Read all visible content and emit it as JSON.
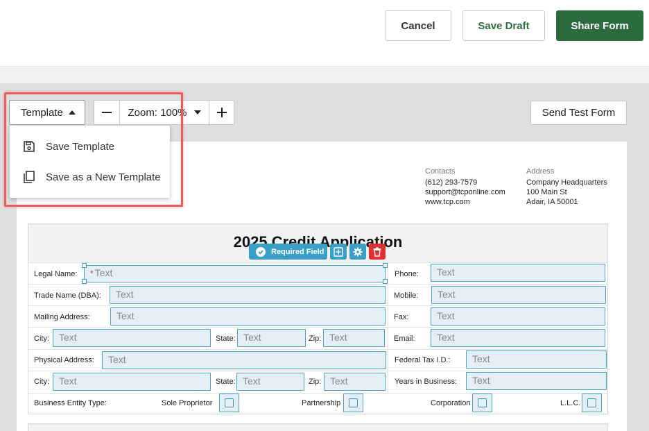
{
  "header": {
    "cancel_label": "Cancel",
    "save_draft_label": "Save Draft",
    "share_form_label": "Share Form",
    "accent_color": "#2b6b3d"
  },
  "toolbar": {
    "template_label": "Template",
    "zoom_label": "Zoom: 100%",
    "send_test_label": "Send Test Form"
  },
  "template_menu": {
    "items": [
      {
        "label": "Save Template",
        "icon": "save-icon"
      },
      {
        "label": "Save as a New Template",
        "icon": "copy-icon"
      }
    ]
  },
  "company": {
    "contacts_heading": "Contacts",
    "phone": "(612) 293-7579",
    "email": "support@tcponline.com",
    "web": "www.tcp.com",
    "address_heading": "Address",
    "address_line1": "Company Headquarters",
    "address_line2": "100 Main St",
    "address_line3": "Adair, IA 50001"
  },
  "form": {
    "title": "2025 Credit Application",
    "required_field_label": "Required Field",
    "placeholder": "Text",
    "required_marker": "*",
    "labels": {
      "legal_name": "Legal Name:",
      "trade_name": "Trade Name (DBA):",
      "mailing_address": "Mailing Address:",
      "city": "City:",
      "state": "State:",
      "zip": "Zip:",
      "physical_address": "Physical Address:",
      "phone": "Phone:",
      "mobile": "Mobile:",
      "fax": "Fax:",
      "email": "Email:",
      "federal_tax": "Federal Tax I.D.:",
      "years_in_business": "Years in Business:",
      "entity_type": "Business Entity Type:",
      "sole_proprietor": "Sole Proprietor",
      "partnership": "Partnership",
      "corporation": "Corporation",
      "llc": "L.L.C."
    }
  }
}
